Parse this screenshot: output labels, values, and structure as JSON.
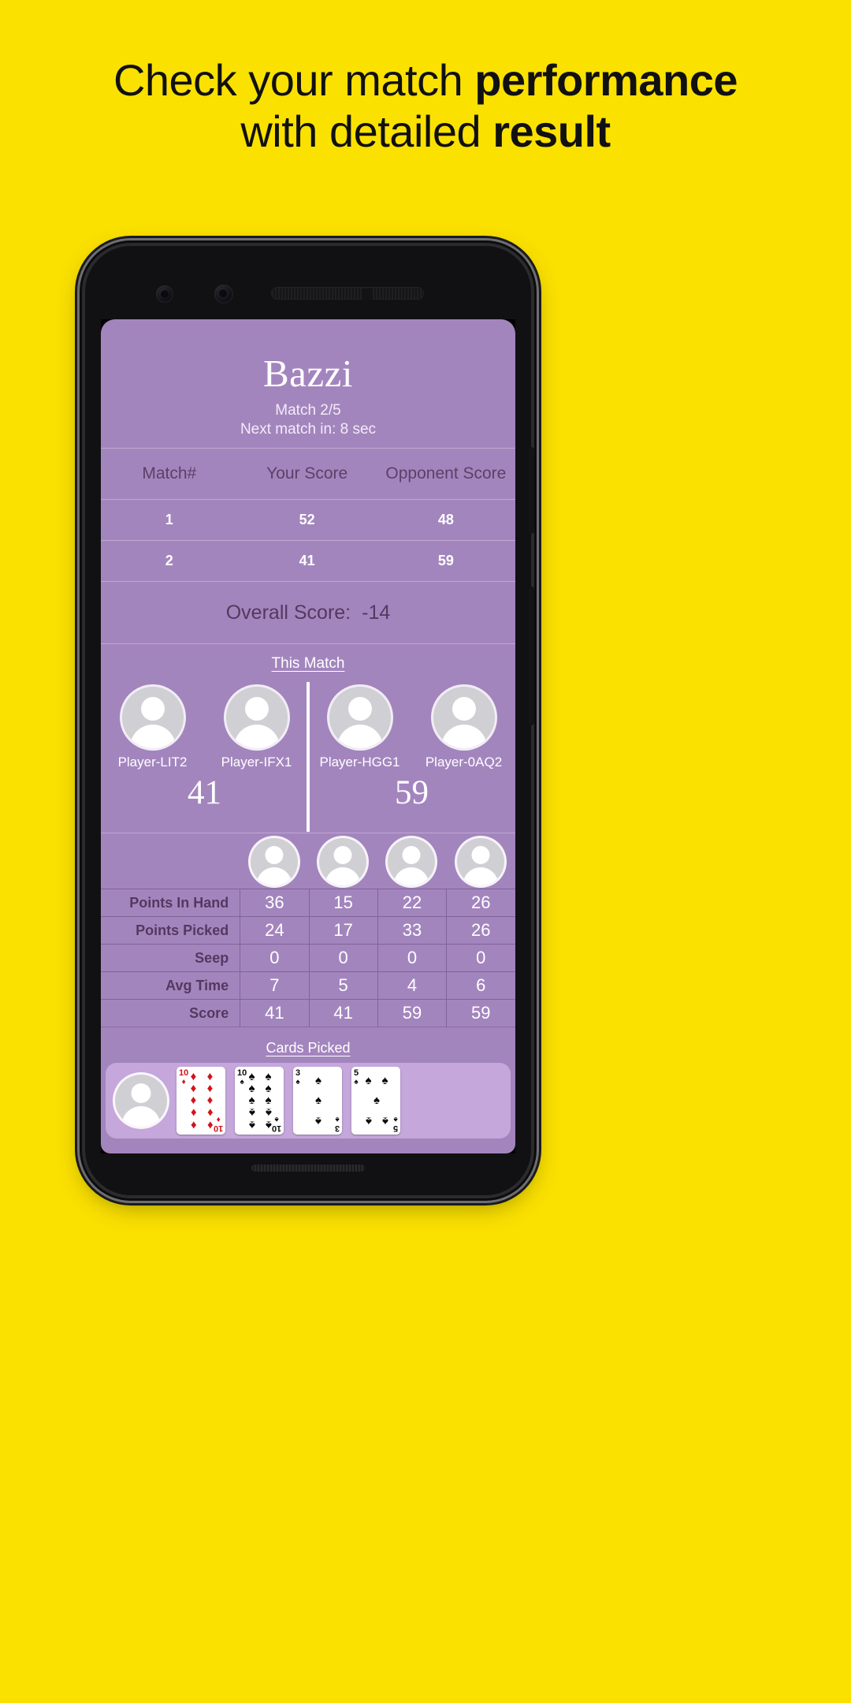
{
  "headline": {
    "line1_plain": "Check your match ",
    "line1_bold": "performance",
    "line2_plain": "with detailed ",
    "line2_bold": "result"
  },
  "colors": {
    "background": "#FBE100",
    "app_surface": "#A385BE",
    "strip": "#C5A7DC",
    "label_text": "#54395F",
    "value_text": "#FFFFFF"
  },
  "app": {
    "title": "Bazzi",
    "match_progress": "Match 2/5",
    "next_match": "Next match in: 8 sec",
    "score_table": {
      "headers": [
        "Match#",
        "Your Score",
        "Opponent Score"
      ],
      "rows": [
        [
          "1",
          "52",
          "48"
        ],
        [
          "2",
          "41",
          "59"
        ]
      ]
    },
    "overall": {
      "label": "Overall Score:",
      "value": "-14"
    },
    "this_match_link": "This Match",
    "teams": {
      "left": {
        "players": [
          "Player-LIT2",
          "Player-IFX1"
        ],
        "score": "41"
      },
      "right": {
        "players": [
          "Player-HGG1",
          "Player-0AQ2"
        ],
        "score": "59"
      }
    },
    "stats": {
      "rows": [
        {
          "label": "Points In Hand",
          "values": [
            "36",
            "15",
            "22",
            "26"
          ]
        },
        {
          "label": "Points Picked",
          "values": [
            "24",
            "17",
            "33",
            "26"
          ]
        },
        {
          "label": "Seep",
          "values": [
            "0",
            "0",
            "0",
            "0"
          ]
        },
        {
          "label": "Avg Time",
          "values": [
            "7",
            "5",
            "4",
            "6"
          ]
        },
        {
          "label": "Score",
          "values": [
            "41",
            "41",
            "59",
            "59"
          ]
        }
      ]
    },
    "cards_picked_link": "Cards Picked",
    "cards": [
      {
        "rank": "10",
        "suit": "♦",
        "color": "red"
      },
      {
        "rank": "10",
        "suit": "♠",
        "color": "black"
      },
      {
        "rank": "3",
        "suit": "♠",
        "color": "black"
      },
      {
        "rank": "5",
        "suit": "♠",
        "color": "black"
      }
    ]
  }
}
